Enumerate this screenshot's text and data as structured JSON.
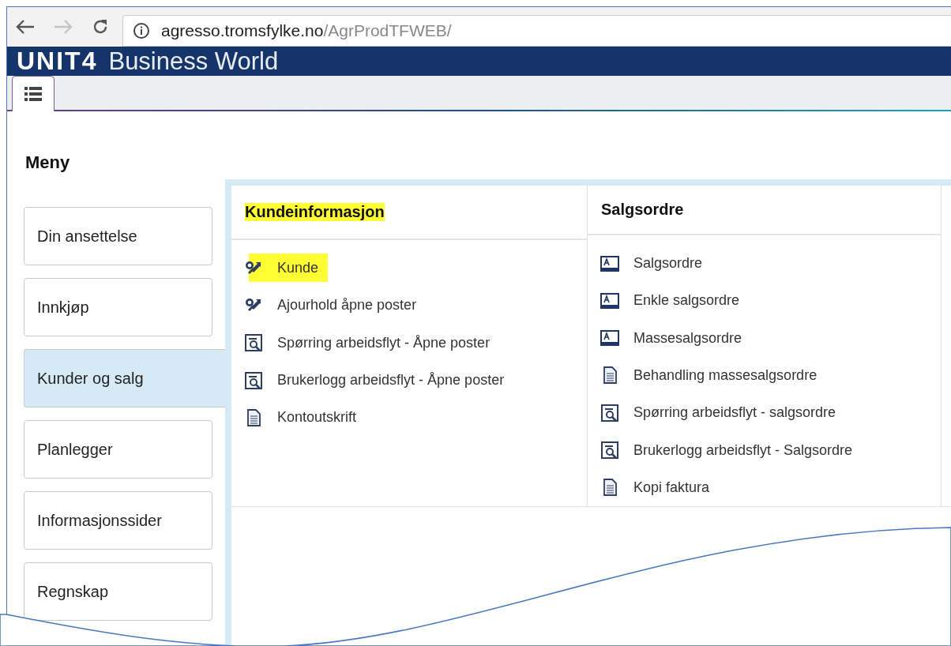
{
  "browser": {
    "url_host": "agresso.tromsfylke.no",
    "url_path": "/AgrProdTFWEB/"
  },
  "header": {
    "logo": "UNIT4",
    "title": "Business World"
  },
  "menu_title": "Meny",
  "sidebar": {
    "items": [
      {
        "label": "Din ansettelse",
        "selected": false
      },
      {
        "label": "Innkjøp",
        "selected": false
      },
      {
        "label": "Kunder og salg",
        "selected": true
      },
      {
        "label": "Planlegger",
        "selected": false
      },
      {
        "label": "Informasjonssider",
        "selected": false
      },
      {
        "label": "Regnskap",
        "selected": false
      }
    ]
  },
  "columns": [
    {
      "heading": "Kundeinformasjon",
      "highlighted": true,
      "items": [
        {
          "label": "Kunde",
          "kind": "tool",
          "highlighted": true
        },
        {
          "label": "Ajourhold åpne poster",
          "kind": "tool",
          "highlighted": false
        },
        {
          "label": "Spørring arbeidsflyt - Åpne poster",
          "kind": "query",
          "highlighted": false
        },
        {
          "label": "Brukerlogg arbeidsflyt - Åpne poster",
          "kind": "query",
          "highlighted": false
        },
        {
          "label": "Kontoutskrift",
          "kind": "document",
          "highlighted": false
        }
      ]
    },
    {
      "heading": "Salgsordre",
      "highlighted": false,
      "items": [
        {
          "label": "Salgsordre",
          "kind": "form",
          "highlighted": false
        },
        {
          "label": "Enkle salgsordre",
          "kind": "form",
          "highlighted": false
        },
        {
          "label": "Massesalgsordre",
          "kind": "form",
          "highlighted": false
        },
        {
          "label": "Behandling massesalgsordre",
          "kind": "document",
          "highlighted": false
        },
        {
          "label": "Spørring arbeidsflyt - salgsordre",
          "kind": "query",
          "highlighted": false
        },
        {
          "label": "Brukerlogg arbeidsflyt - Salgsordre",
          "kind": "query",
          "highlighted": false
        },
        {
          "label": "Kopi faktura",
          "kind": "document",
          "highlighted": false
        }
      ]
    }
  ]
}
